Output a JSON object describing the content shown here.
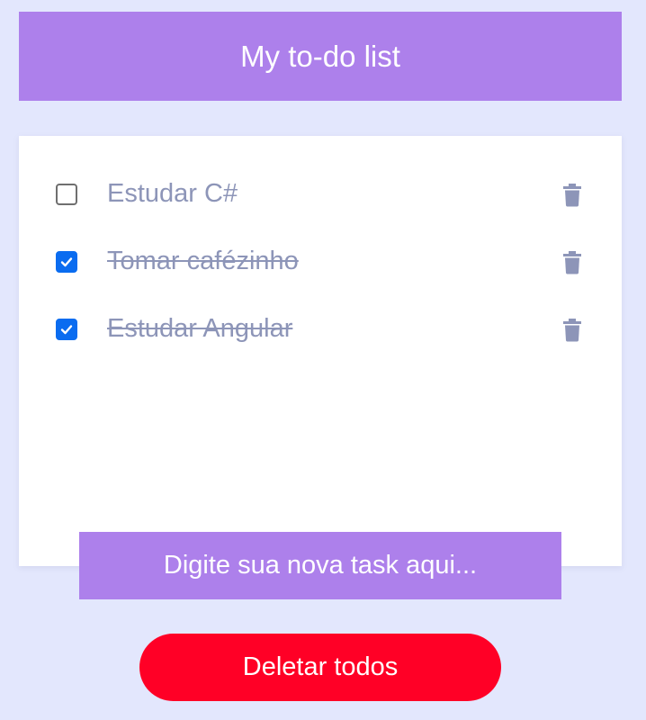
{
  "header": {
    "title": "My to-do list"
  },
  "tasks": [
    {
      "label": "Estudar C#",
      "done": false
    },
    {
      "label": "Tomar cafézinho",
      "done": true
    },
    {
      "label": "Estudar Angular",
      "done": true
    }
  ],
  "new_task": {
    "placeholder": "Digite sua nova task aqui...",
    "value": ""
  },
  "actions": {
    "delete_all_label": "Deletar todos"
  },
  "colors": {
    "background": "#e3e7fd",
    "accent": "#ad80eb",
    "danger": "#ff0026",
    "checkbox_checked": "#0a6cf0",
    "task_text": "#8d95b8",
    "trash_icon": "#8d95b8"
  },
  "icons": {
    "checkbox_checked": "check-icon",
    "delete_task": "trash-icon"
  }
}
